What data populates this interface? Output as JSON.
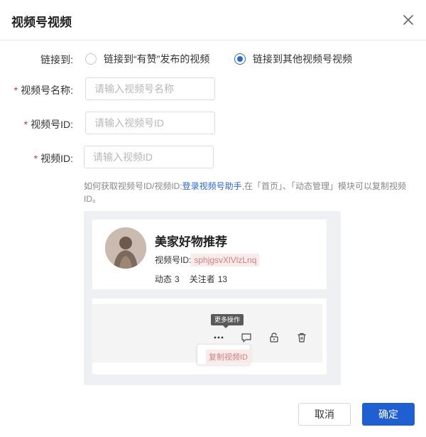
{
  "dialog": {
    "title": "视频号视频",
    "cancel_label": "取消",
    "confirm_label": "确定"
  },
  "link": {
    "label": "链接到:",
    "options": [
      {
        "label": "链接到“有赞”发布的视频",
        "checked": false
      },
      {
        "label": "链接到其他视频号视频",
        "checked": true
      }
    ]
  },
  "fields": {
    "required_mark": "*",
    "channel_name": {
      "label": "视频号名称:",
      "placeholder": "请输入视频号名称",
      "value": ""
    },
    "channel_id": {
      "label": "视频号ID:",
      "placeholder": "请输入视频号ID",
      "value": ""
    },
    "video_id": {
      "label": "视频ID:",
      "placeholder": "请输入视频ID",
      "value": ""
    }
  },
  "help": {
    "prefix": "如何获取视频号ID/视频ID:",
    "link": "登录视频号助手",
    "suffix": ",在「首页」、「动态管理」模块可以复制视频ID。"
  },
  "example": {
    "nickname": "美家好物推荐",
    "id_label": "视频号ID:",
    "id_value": "sphjgsvXlVlzLnq",
    "posts_label": "动态",
    "posts_count": "3",
    "followers_label": "关注者",
    "followers_count": "13",
    "tooltip": "更多操作",
    "copy_label": "复制视频ID",
    "icons": [
      "more-icon",
      "comment-icon",
      "lock-icon",
      "trash-icon"
    ]
  },
  "colors": {
    "primary": "#1f5fd1",
    "required": "#e03131",
    "link": "#2a66d8",
    "highlight_bg": "#fbeaea"
  }
}
